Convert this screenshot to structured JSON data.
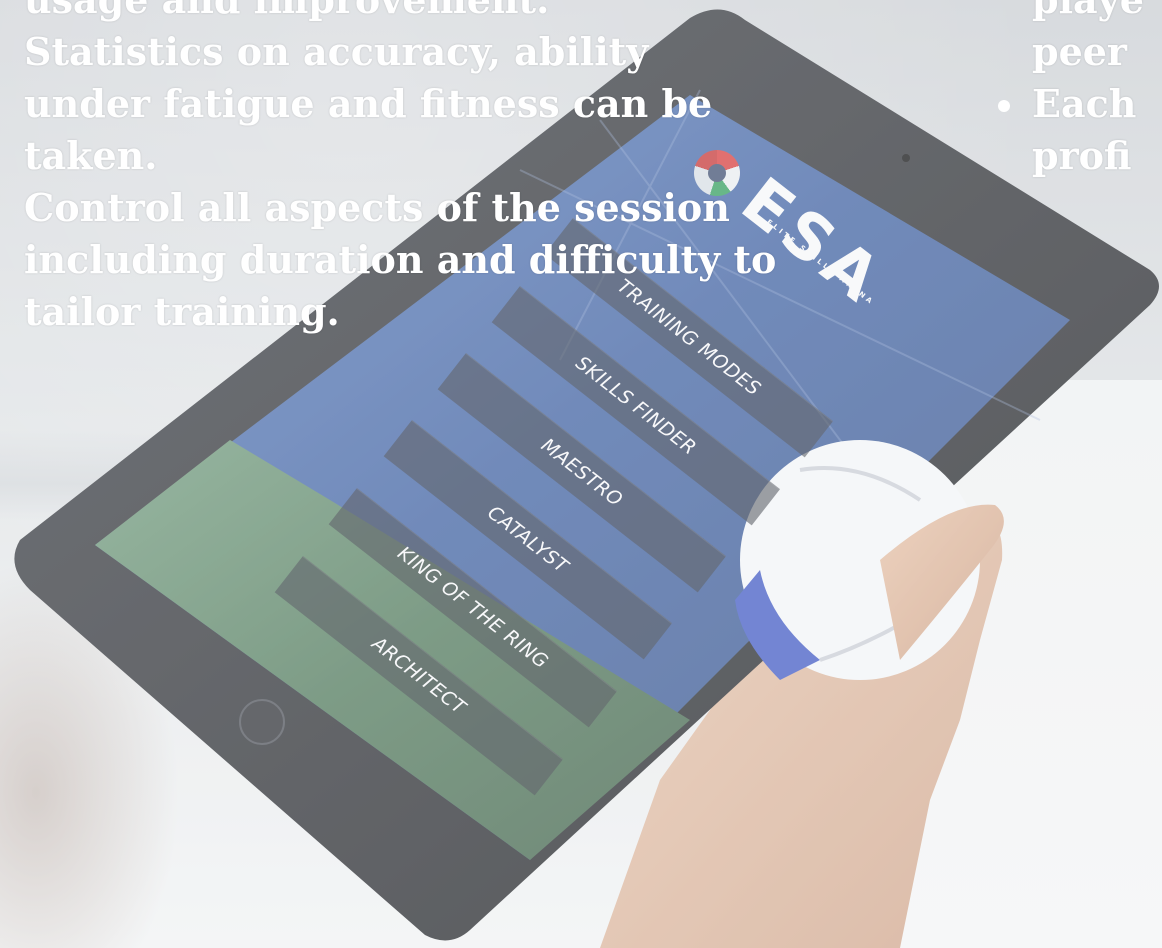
{
  "overlay": {
    "left_lines": [
      "usage and improvement.",
      "Statistics on accuracy, ability",
      "under fatigue and fitness can be",
      "taken.",
      "Control all aspects of the session",
      "including duration and difficulty to",
      "tailor training."
    ],
    "right_lines": [
      "playe",
      "peer",
      "Each",
      "profi"
    ]
  },
  "tablet": {
    "brand": "ESA",
    "brand_sub": "ELITE SKILLS ARENA",
    "menu_items": [
      "TRAINING MODES",
      "SKILLS FINDER",
      "MAESTRO",
      "CATALYST",
      "KING OF THE RING",
      "ARCHITECT"
    ]
  },
  "colors": {
    "overlay_text": "#ffffff",
    "tablet_frame": "#1c1f24",
    "screen_sky": "#3f63a8",
    "grass": "#4f7a5d"
  }
}
